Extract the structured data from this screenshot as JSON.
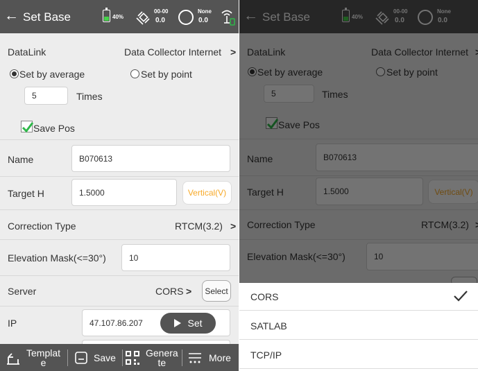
{
  "screen": {
    "back_glyph": "←",
    "title": "Set Base",
    "status": {
      "battery_text": "40%",
      "battery_level": 0.4,
      "sat_time": "00-00",
      "sat_value": "0.0",
      "solution": "None",
      "solution_value": "0.0"
    },
    "datalink": {
      "label": "DataLink",
      "value": "Data Collector Internet"
    },
    "set_mode": {
      "average_label": "Set by average",
      "point_label": "Set by point",
      "selected": "average"
    },
    "times": {
      "value": "5",
      "label": "Times"
    },
    "save_pos": {
      "label": "Save Pos",
      "checked": true
    },
    "name": {
      "label": "Name",
      "value": "B070613"
    },
    "target_h": {
      "label": "Target H",
      "value": "1.5000",
      "mode_button": "Vertical(V)"
    },
    "correction_type": {
      "label": "Correction Type",
      "value": "RTCM(3.2)"
    },
    "elevation_mask": {
      "label": "Elevation Mask(<=30°)",
      "value": "10"
    },
    "server": {
      "label": "Server",
      "value": "CORS",
      "select_button": "Select"
    },
    "ip": {
      "label": "IP",
      "value": "47.107.86.207",
      "set_button": "Set"
    },
    "chevron": ">",
    "bottombar": {
      "template_line1": "Templat",
      "template_line2": "e",
      "save": "Save",
      "generate_line1": "Genera",
      "generate_line2": "te",
      "more": "More"
    }
  },
  "server_picker": {
    "options": [
      "CORS",
      "SATLAB",
      "TCP/IP"
    ],
    "selected": "CORS"
  },
  "colors": {
    "header": "#545454",
    "background": "#ededed",
    "accent_orange": "#f7a928",
    "check_green": "#2fb84a",
    "battery_green": "#46d24a"
  },
  "icons": [
    "back-arrow-icon",
    "battery-icon",
    "satellite-icon",
    "solution-ring-icon",
    "antenna-icon",
    "chevron-right-icon",
    "checkmark-icon",
    "play-icon",
    "template-icon",
    "save-icon",
    "qr-code-icon",
    "more-icon"
  ]
}
